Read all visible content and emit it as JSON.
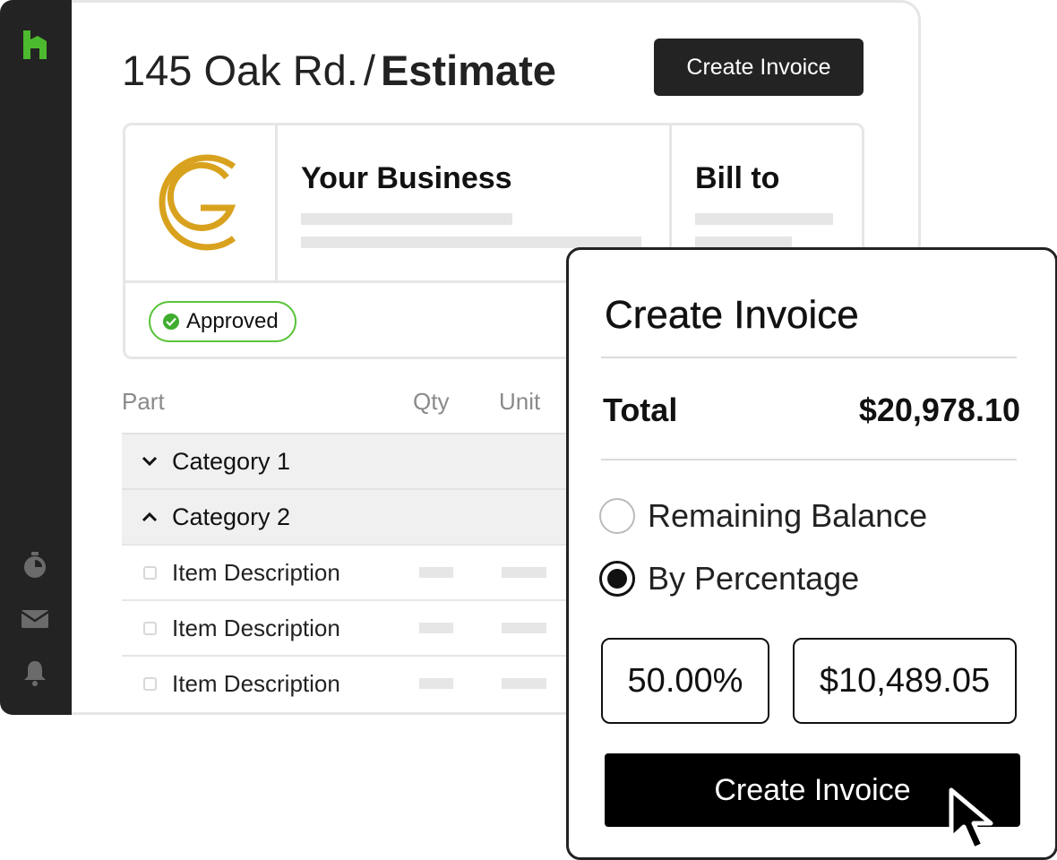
{
  "sidebar": {
    "logo_icon": "house-logo-icon",
    "logo_color": "#4cba2e",
    "icons": [
      "timer-icon",
      "mail-icon",
      "bell-icon"
    ]
  },
  "header": {
    "address": "145 Oak Rd.",
    "separator": "/",
    "page_title": "Estimate",
    "create_invoice_label": "Create Invoice"
  },
  "estimate_card": {
    "logo_icon": "g-brand-logo-icon",
    "logo_color": "#d9a21e",
    "business_heading": "Your Business",
    "bill_to_heading": "Bill to",
    "status_badge": "Approved",
    "status_color": "#5ac43a"
  },
  "table": {
    "columns": [
      "Part",
      "Qty",
      "Unit"
    ],
    "categories": [
      {
        "label": "Category 1",
        "expanded": false
      },
      {
        "label": "Category 2",
        "expanded": true
      }
    ],
    "items": [
      "Item Description",
      "Item Description",
      "Item Description"
    ]
  },
  "modal": {
    "title": "Create Invoice",
    "total_label": "Total",
    "total_value": "$20,978.10",
    "options": [
      {
        "label": "Remaining Balance",
        "selected": false
      },
      {
        "label": "By Percentage",
        "selected": true
      }
    ],
    "percentage_value": "50.00%",
    "amount_value": "$10,489.05",
    "submit_label": "Create Invoice"
  }
}
